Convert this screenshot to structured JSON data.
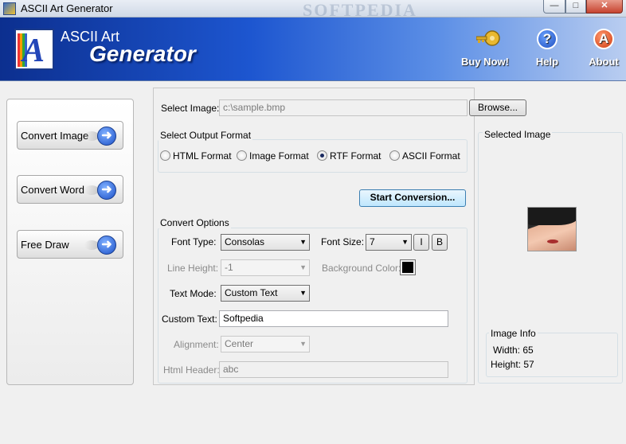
{
  "window": {
    "title": "ASCII Art Generator",
    "watermark": "SOFTPEDIA",
    "minimize": "—",
    "maximize": "□",
    "close": "✕"
  },
  "header": {
    "title_line1": "ASCII Art",
    "title_line2": "Generator",
    "buy_now": "Buy Now!",
    "help": "Help",
    "about": "About",
    "help_glyph": "?",
    "about_glyph": "A"
  },
  "nav": {
    "items": [
      {
        "label": "Convert Image",
        "icon": "arrow-right-icon"
      },
      {
        "label": "Convert Word",
        "icon": "arrow-right-icon"
      },
      {
        "label": "Free Draw",
        "icon": "arrow-right-icon"
      }
    ]
  },
  "main": {
    "select_image_label": "Select Image:",
    "select_image_value": "c:\\sample.bmp",
    "browse": "Browse...",
    "output_format_title": "Select Output Format",
    "formats": [
      {
        "label": "HTML Format",
        "selected": false
      },
      {
        "label": "Image Format",
        "selected": false
      },
      {
        "label": "RTF Format",
        "selected": true
      },
      {
        "label": "ASCII Format",
        "selected": false
      }
    ],
    "start_conversion": "Start Conversion...",
    "convert_options_title": "Convert Options",
    "font_type_label": "Font Type:",
    "font_type_value": "Consolas",
    "font_size_label": "Font Size:",
    "font_size_value": "7",
    "italic": "I",
    "bold": "B",
    "line_height_label": "Line Height:",
    "line_height_value": "-1",
    "background_color_label": "Background Color:",
    "background_color": "#000000",
    "text_mode_label": "Text Mode:",
    "text_mode_value": "Custom Text",
    "custom_text_label": "Custom Text:",
    "custom_text_value": "Softpedia",
    "alignment_label": "Alignment:",
    "alignment_value": "Center",
    "html_header_label": "Html Header:",
    "html_header_value": "abc"
  },
  "right": {
    "selected_image_title": "Selected Image",
    "image_info_title": "Image Info",
    "width_label": "Width: 65",
    "height_label": "Height: 57"
  }
}
